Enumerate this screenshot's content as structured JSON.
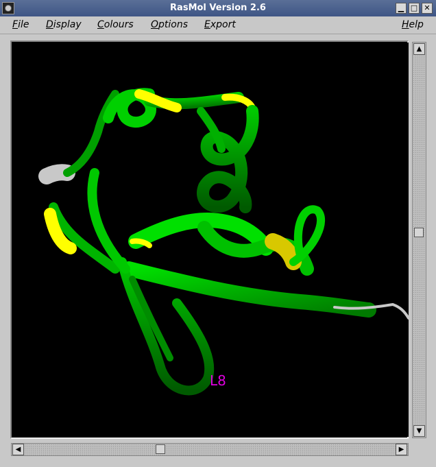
{
  "window": {
    "title": "RasMol Version 2.6",
    "controls": {
      "minimize": "▁",
      "maximize": "□",
      "close": "✕"
    }
  },
  "menubar": {
    "items": [
      {
        "label": "File",
        "underline": "F",
        "rest": "ile"
      },
      {
        "label": "Display",
        "underline": "D",
        "rest": "isplay"
      },
      {
        "label": "Colours",
        "underline": "C",
        "rest": "olours"
      },
      {
        "label": "Options",
        "underline": "O",
        "rest": "ptions"
      },
      {
        "label": "Export",
        "underline": "E",
        "rest": "xport"
      },
      {
        "label": "Help",
        "underline": "H",
        "rest": "elp"
      }
    ]
  },
  "viewer": {
    "background": "#000000",
    "ribbon_color_helix": "#00d800",
    "ribbon_color_sheet": "#ffff00",
    "ribbon_color_coil": "#c8c8c8",
    "label": "L8",
    "label_color": "#e000e0"
  },
  "scrollbars": {
    "up_arrow": "▲",
    "down_arrow": "▼",
    "left_arrow": "◀",
    "right_arrow": "▶"
  }
}
